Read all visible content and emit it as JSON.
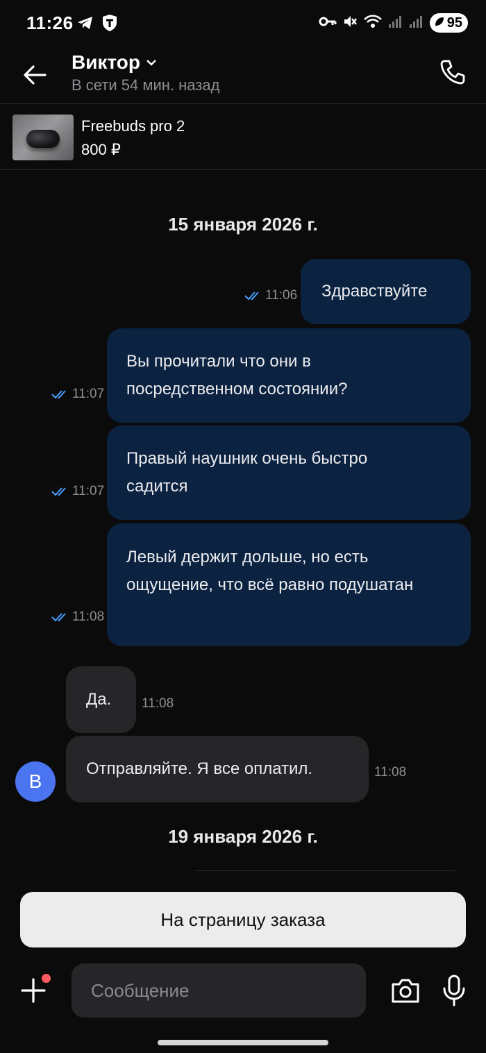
{
  "status_bar": {
    "time": "11:26",
    "battery": "95"
  },
  "header": {
    "name": "Виктор",
    "status": "В сети 54 мин. назад"
  },
  "product": {
    "title": "Freebuds pro 2",
    "price": "800 ₽"
  },
  "chat": {
    "date1": "15 января 2026 г.",
    "date2": "19 января 2026 г.",
    "messages": [
      {
        "text": "Здравствуйте",
        "time": "11:06"
      },
      {
        "text": "Вы прочитали что они в посредственном состоянии?",
        "time": "11:07"
      },
      {
        "text": "Правый наушник очень быстро садится",
        "time": "11:07"
      },
      {
        "text": "Левый держит дольше, но есть ощущение, что всё равно подушатан",
        "time": "11:08"
      },
      {
        "text": "Да.",
        "time": "11:08"
      },
      {
        "text": "Отправляйте. Я все оплатил.",
        "time": "11:08"
      }
    ],
    "avatar_letter": "В"
  },
  "order_button": "На страницу заказа",
  "composer": {
    "placeholder": "Сообщение"
  },
  "colors": {
    "outgoing_bubble": "#0b2240",
    "incoming_bubble": "#262628",
    "read_check": "#4a9fff",
    "avatar": "#4b74f0",
    "notification_dot": "#ff5a5f"
  }
}
